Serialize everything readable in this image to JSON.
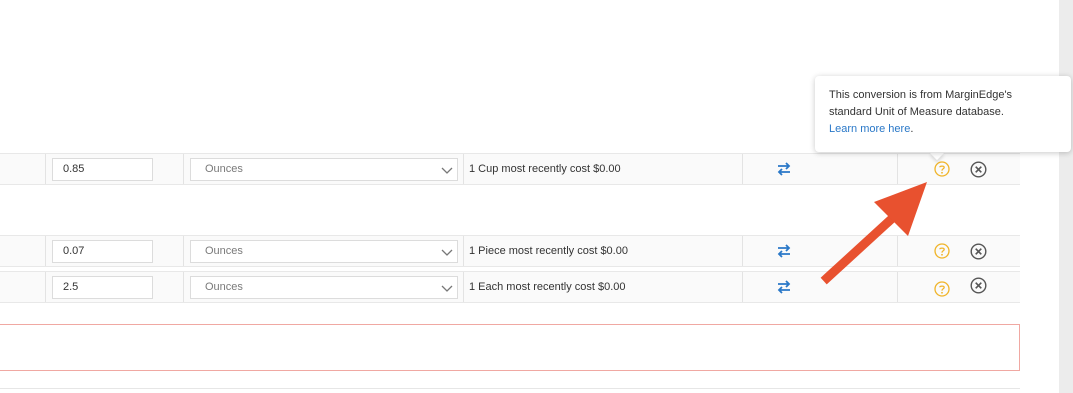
{
  "rows": [
    {
      "quantity": "0.85",
      "unit": "Ounces",
      "cost_text": "1 Cup most recently cost $0.00"
    },
    {
      "quantity": "0.07",
      "unit": "Ounces",
      "cost_text": "1 Piece most recently cost $0.00"
    },
    {
      "quantity": "2.5",
      "unit": "Ounces",
      "cost_text": "1 Each most recently cost $0.00"
    }
  ],
  "tooltip": {
    "text_line1": "This conversion is from MarginEdge's",
    "text_line2": "standard Unit of Measure database.",
    "link_text": "Learn more here",
    "trailing": "."
  },
  "icons": {
    "swap": "swap-arrows-icon",
    "help": "help-circle-icon",
    "remove": "remove-circle-icon",
    "dropdown": "chevron-down-icon",
    "annotation": "annotation-arrow"
  },
  "colors": {
    "link": "#2a78c8",
    "help_icon": "#f0b429",
    "annotation_arrow": "#e8512f",
    "error_border": "#f0a8a2"
  }
}
